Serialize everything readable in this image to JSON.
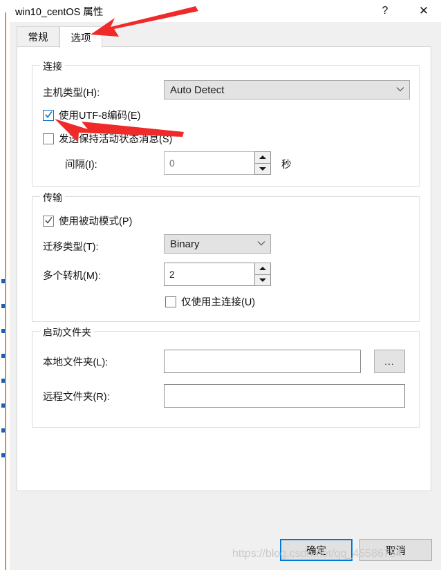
{
  "window": {
    "title": "win10_centOS 属性",
    "help_label": "?",
    "close_label": "✕"
  },
  "tabs": [
    {
      "label": "常规",
      "active": false
    },
    {
      "label": "选项",
      "active": true
    }
  ],
  "groups": {
    "connection": {
      "legend": "连接",
      "host_type_label": "主机类型(H):",
      "host_type_value": "Auto Detect",
      "host_type_chevron": "chevron-down-icon",
      "utf8_label": "使用UTF-8编码(E)",
      "utf8_checked": "checked",
      "keepalive_label": "发送保持活动状态消息(S)",
      "keepalive_checked": "unchecked",
      "interval_label": "间隔(I):",
      "interval_value": "0",
      "interval_unit": "秒"
    },
    "transfer": {
      "legend": "传输",
      "passive_label": "使用被动模式(P)",
      "passive_checked": "checked",
      "transfer_type_label": "迁移类型(T):",
      "transfer_type_value": "Binary",
      "multiple_label": "多个转机(M):",
      "multiple_value": "2",
      "primary_only_label": "仅使用主连接(U)",
      "primary_only_checked": "unchecked"
    },
    "startup": {
      "legend": "启动文件夹",
      "local_label": "本地文件夹(L):",
      "local_value": "",
      "local_placeholder": "",
      "browse_label": "...",
      "remote_label": "远程文件夹(R):",
      "remote_value": "",
      "remote_placeholder": ""
    }
  },
  "footer": {
    "ok_label": "确定",
    "cancel_label": "取消"
  },
  "watermark": "https://blog.csdn.net/qq_45586754",
  "colors": {
    "accent": "#0078d7",
    "annotation": "#ef2a29",
    "dialog_bg": "#f0f0f0",
    "panel_bg": "#ffffff",
    "control_bg": "#e3e3e3"
  }
}
